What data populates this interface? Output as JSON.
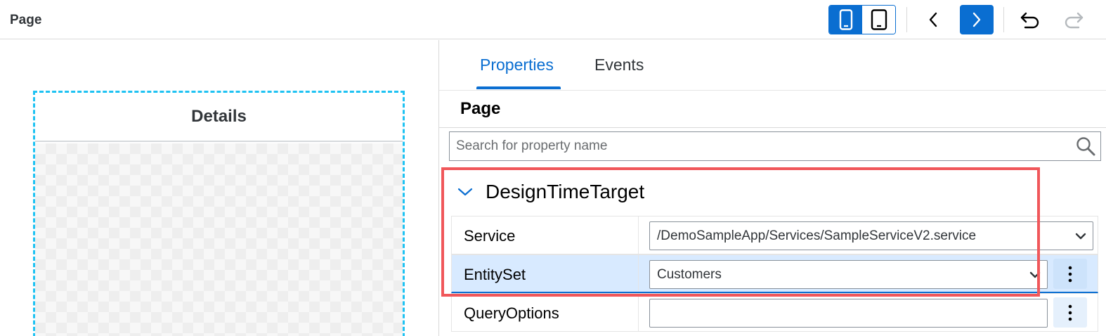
{
  "topbar": {
    "title": "Page",
    "icons": {
      "phone": "phone-icon",
      "tablet": "tablet-icon",
      "prev": "chevron-left-icon",
      "next": "chevron-right-icon",
      "undo": "undo-icon",
      "redo": "redo-icon"
    }
  },
  "canvas": {
    "header_title": "Details"
  },
  "panel": {
    "tabs": [
      {
        "label": "Properties",
        "active": true
      },
      {
        "label": "Events",
        "active": false
      }
    ],
    "section_title": "Page",
    "search": {
      "placeholder": "Search for property name",
      "value": ""
    },
    "group": {
      "title": "DesignTimeTarget",
      "expanded": true,
      "rows": [
        {
          "label": "Service",
          "value": "/DemoSampleApp/Services/SampleServiceV2.service"
        },
        {
          "label": "EntitySet",
          "value": "Customers"
        },
        {
          "label": "QueryOptions",
          "value": ""
        }
      ]
    }
  },
  "colors": {
    "accent": "#0a6ed1",
    "highlight": "#f0575a",
    "selection_dashed": "#1ec2f2",
    "selected_row": "#d8eaff"
  }
}
